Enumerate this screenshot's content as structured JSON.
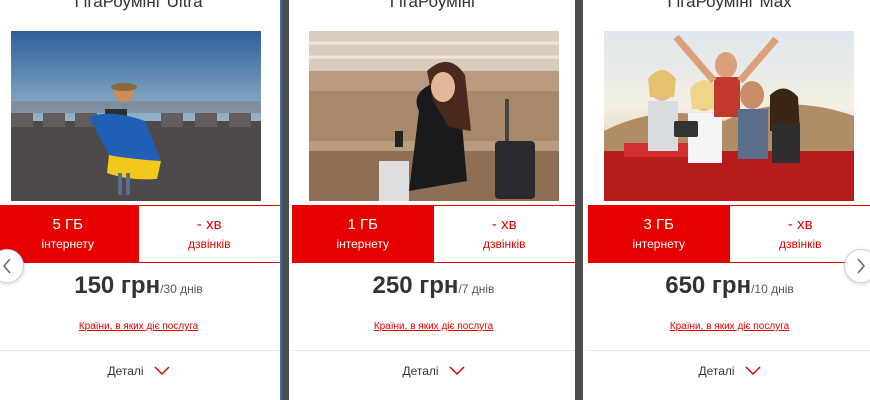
{
  "cards": [
    {
      "title": "ГігаРоумінг Ultra",
      "photo": "woman-with-ukrainian-flag-photo",
      "internet_value": "5 ГБ",
      "internet_unit": "інтернету",
      "calls_value": "- хв",
      "calls_unit": "дзвінків",
      "price": "150 грн",
      "period": "/30 днів",
      "countries_link": "Країни, в яких діє послуга",
      "details_label": "Деталі"
    },
    {
      "title": "ГігаРоумінг",
      "photo": "woman-with-phone-at-airport-photo",
      "internet_value": "1 ГБ",
      "internet_unit": "інтернету",
      "calls_value": "- хв",
      "calls_unit": "дзвінків",
      "price": "250 грн",
      "period": "/7 днів",
      "countries_link": "Країни, в яких діє послуга",
      "details_label": "Деталі"
    },
    {
      "title": "ГігаРоумінг Max",
      "photo": "friends-selfie-in-convertible-photo",
      "internet_value": "3 ГБ",
      "internet_unit": "інтернету",
      "calls_value": "- хв",
      "calls_unit": "дзвінків",
      "price": "650 грн",
      "period": "/10 днів",
      "countries_link": "Країни, в яких діє послуга",
      "details_label": "Деталі"
    }
  ],
  "carousel": {
    "prev_icon": "chevron-left-icon",
    "next_icon": "chevron-right-icon"
  },
  "colors": {
    "accent": "#e60000",
    "divider": "#4a4d4e",
    "text": "#333333"
  }
}
